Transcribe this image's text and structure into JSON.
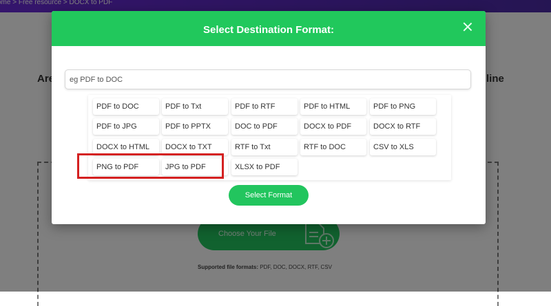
{
  "breadcrumb": {
    "home": "ome",
    "sep1": " > ",
    "free_resource": "Free resource",
    "sep2": " > ",
    "current": "DOCX to PDF"
  },
  "background": {
    "headline_left": "Are",
    "headline_right": "line",
    "choose_file_label": "Choose Your File",
    "supported_label": "Supported file formats:",
    "supported_formats": " PDF, DOC, DOCX, RTF, CSV"
  },
  "modal": {
    "title": "Select Destination Format:",
    "search_placeholder": "eg PDF to DOC",
    "formats": [
      [
        "PDF to DOC",
        "PDF to Txt",
        "PDF to RTF",
        "PDF to HTML",
        "PDF to PNG"
      ],
      [
        "PDF to JPG",
        "PDF to PPTX",
        "DOC to PDF",
        "DOCX to PDF",
        "DOCX to RTF"
      ],
      [
        "DOCX to HTML",
        "DOCX to TXT",
        "RTF to Txt",
        "RTF to DOC",
        "CSV to XLS"
      ],
      [
        "PNG to PDF",
        "JPG to PDF",
        "XLSX to PDF"
      ]
    ],
    "select_button": "Select Format"
  },
  "colors": {
    "accent_green": "#21c85c",
    "highlight_red": "#d42020",
    "topbar_purple": "#5a2bc0"
  }
}
